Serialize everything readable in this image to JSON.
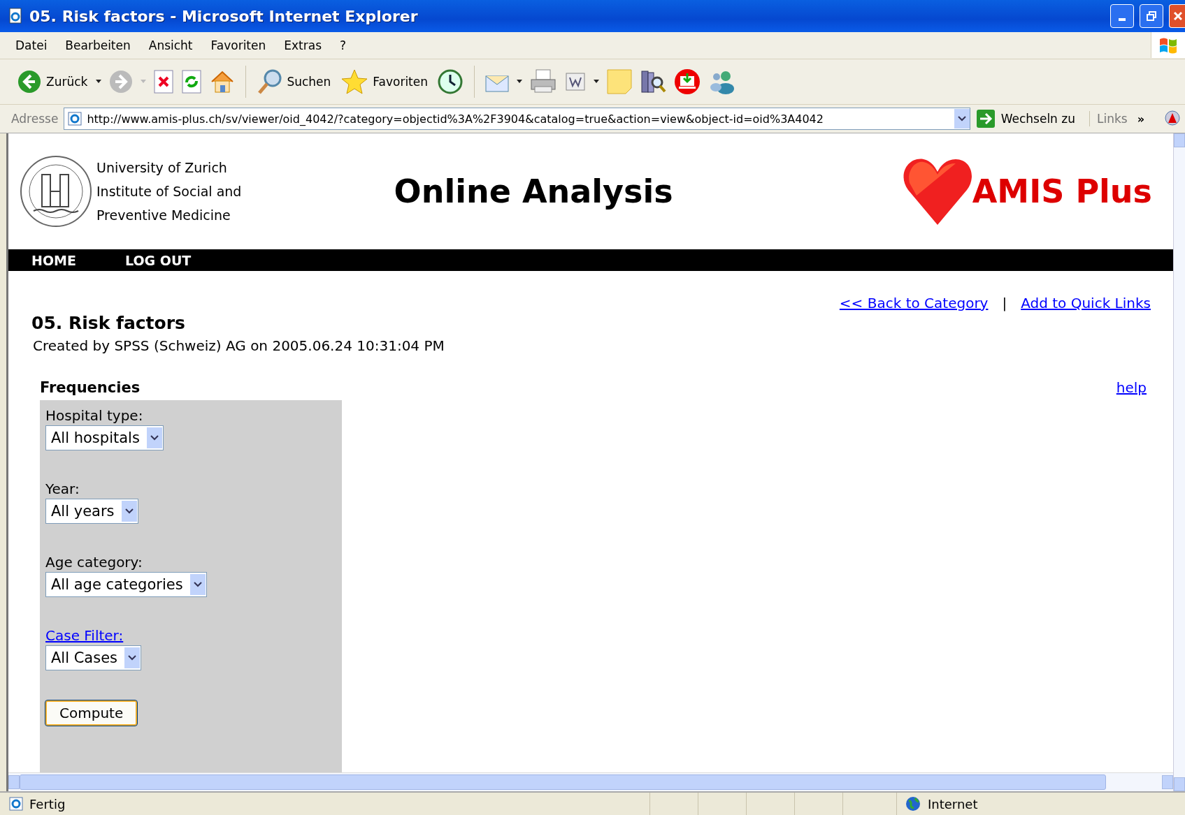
{
  "window": {
    "title": "05. Risk factors - Microsoft Internet Explorer"
  },
  "menu": [
    "Datei",
    "Bearbeiten",
    "Ansicht",
    "Favoriten",
    "Extras",
    "?"
  ],
  "toolbar": {
    "back": "Zurück",
    "search": "Suchen",
    "favorites": "Favoriten"
  },
  "address": {
    "label": "Adresse",
    "value": "http://www.amis-plus.ch/sv/viewer/oid_4042/?category=objectid%3A%2F3904&catalog=true&action=view&object-id=oid%3A4042",
    "go": "Wechseln zu",
    "links": "Links",
    "more": "»"
  },
  "header": {
    "institution": [
      "University of Zurich",
      "Institute of Social and",
      "Preventive Medicine"
    ],
    "title": "Online Analysis",
    "brand": "AMIS Plus"
  },
  "nav": [
    "HOME",
    "LOG OUT"
  ],
  "top_links": [
    "<< Back to Category",
    "Add to Quick Links"
  ],
  "link_separator": "|",
  "heading": "05. Risk factors",
  "created": "Created by SPSS (Schweiz) AG on 2005.06.24 10:31:04 PM",
  "section": "Frequencies",
  "help": "help",
  "fields": [
    {
      "kind": "text",
      "label": "Hospital type:",
      "value": "All hospitals"
    },
    {
      "kind": "text",
      "label": "Year:",
      "value": "All years"
    },
    {
      "kind": "text",
      "label": "Age category:",
      "value": "All age categories"
    },
    {
      "kind": "link",
      "label": "Case Filter:",
      "value": "All Cases"
    }
  ],
  "button": "Compute",
  "status_bar": {
    "text": "Fertig",
    "zone": "Internet"
  }
}
